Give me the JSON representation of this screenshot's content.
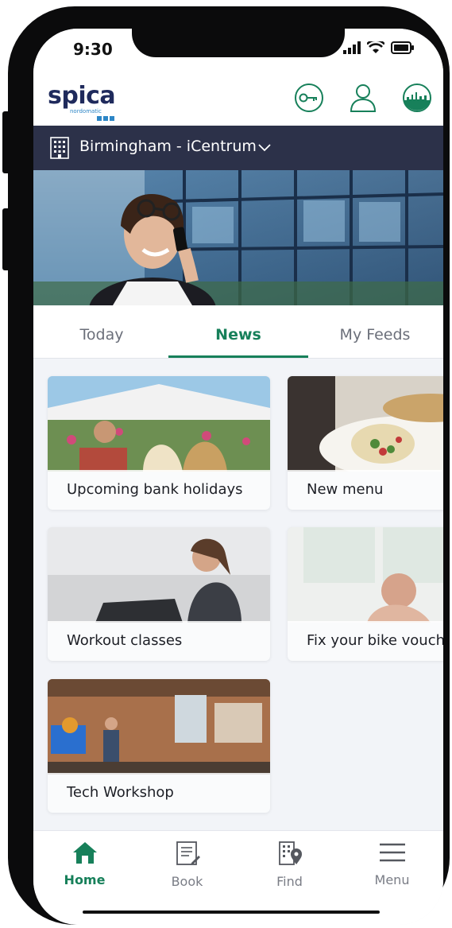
{
  "status_bar": {
    "time": "9:30"
  },
  "app": {
    "brand": "spica",
    "brand_sub": "nordomatic"
  },
  "header_icons": [
    "key-icon",
    "profile-icon",
    "city-skyline-icon"
  ],
  "location": {
    "name": "Birmingham - iCentrum",
    "icon": "building-icon"
  },
  "tabs": [
    {
      "label": "Today",
      "active": false
    },
    {
      "label": "News",
      "active": true
    },
    {
      "label": "My Feeds",
      "active": false
    }
  ],
  "cards": [
    {
      "title": "Upcoming bank holidays"
    },
    {
      "title": "New menu"
    },
    {
      "title": "Workout classes"
    },
    {
      "title": "Fix your bike vouch"
    },
    {
      "title": "Tech Workshop"
    }
  ],
  "bottom_nav": [
    {
      "label": "Home",
      "icon": "home-icon",
      "active": true
    },
    {
      "label": "Book",
      "icon": "book-icon",
      "active": false
    },
    {
      "label": "Find",
      "icon": "find-map-icon",
      "active": false
    },
    {
      "label": "Menu",
      "icon": "hamburger-menu-icon",
      "active": false
    }
  ],
  "colors": {
    "accent": "#17805a",
    "location_bar": "#2c3149",
    "brand": "#1f2a5c"
  }
}
